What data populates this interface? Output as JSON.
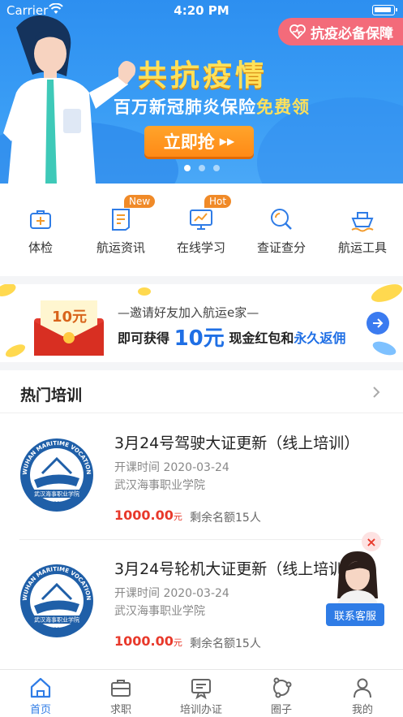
{
  "status": {
    "carrier": "Carrier",
    "time": "4:20 PM"
  },
  "banner": {
    "badge": "抗疫必备保障",
    "headline": "共抗疫情",
    "sub_prefix": "百万新冠肺炎保险",
    "sub_highlight": "免费领",
    "cta": "立即抢",
    "slide_count": 3,
    "active_slide": 1,
    "colors": {
      "bg": "#3a9df5",
      "headline": "#ffe15a",
      "cta": "#ff8a16",
      "badge": "#f36b7a"
    }
  },
  "quick_menu": [
    {
      "label": "体检",
      "icon": "medical-kit-icon"
    },
    {
      "label": "航运资讯",
      "icon": "news-icon",
      "tag": "New"
    },
    {
      "label": "在线学习",
      "icon": "monitor-chart-icon",
      "tag": "Hot"
    },
    {
      "label": "查证查分",
      "icon": "search-icon"
    },
    {
      "label": "航运工具",
      "icon": "ship-icon"
    }
  ],
  "invite": {
    "envelope_amount": "10元",
    "line1": "—邀请好友加入航运e家—",
    "line2_prefix": "即可获得",
    "line2_amount": "10元",
    "line2_mid": "现金红包和",
    "line2_suffix": "永久返佣"
  },
  "hot_training": {
    "title": "热门培训",
    "courses": [
      {
        "title": "3月24号驾驶大证更新（线上培训）",
        "date": "开课时间 2020-03-24",
        "school": "武汉海事职业学院",
        "price": "1000.00",
        "price_unit": "元",
        "quota": "剩余名额15人",
        "logo_text": "WUHAN MARITIME VOCATIONAL COLLEGE",
        "logo_cn": "武汉海事职业学院",
        "logo_year": "1984"
      },
      {
        "title": "3月24号轮机大证更新（线上培训）",
        "date": "开课时间 2020-03-24",
        "school": "武汉海事职业学院",
        "price": "1000.00",
        "price_unit": "元",
        "quota": "剩余名额15人",
        "logo_text": "WUHAN MARITIME VOCATIONAL COLLEGE",
        "logo_cn": "武汉海事职业学院",
        "logo_year": "1984"
      }
    ]
  },
  "service": {
    "label": "联系客服",
    "close_icon": "close-icon"
  },
  "tabbar": [
    {
      "label": "首页",
      "icon": "home-icon",
      "active": true
    },
    {
      "label": "求职",
      "icon": "briefcase-icon"
    },
    {
      "label": "培训办证",
      "icon": "certificate-icon"
    },
    {
      "label": "圈子",
      "icon": "circle-icon"
    },
    {
      "label": "我的",
      "icon": "user-icon"
    }
  ],
  "accent": "#2f7ce6",
  "price_color": "#e8392b"
}
